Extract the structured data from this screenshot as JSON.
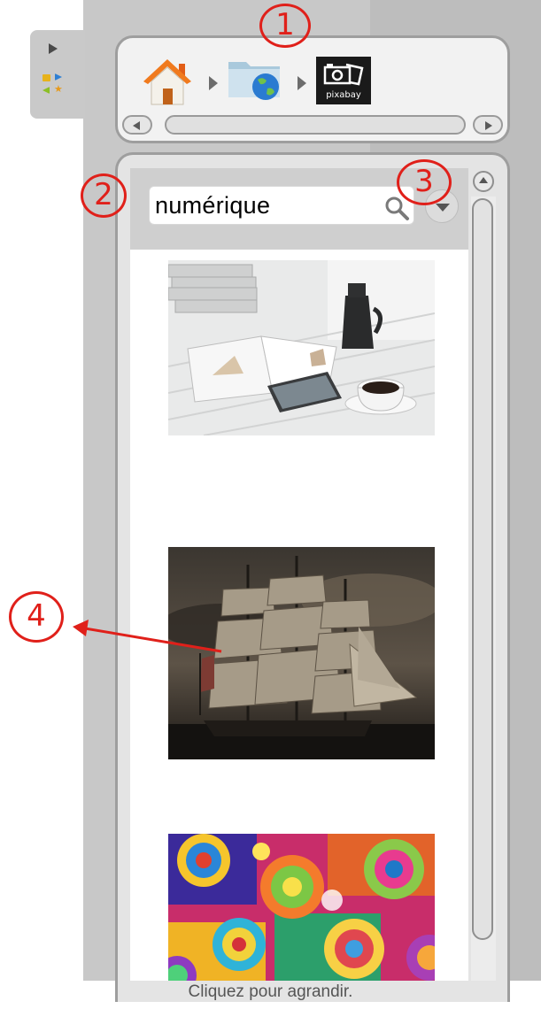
{
  "breadcrumb": {
    "items": [
      {
        "name": "home",
        "icon": "home-icon"
      },
      {
        "name": "web",
        "icon": "globe-folder-icon"
      },
      {
        "name": "pixabay",
        "icon": "camera-icon",
        "label": "pixabay"
      }
    ]
  },
  "search": {
    "value": "numérique"
  },
  "annotations": {
    "one": "1",
    "two": "2",
    "three": "3",
    "four": "4"
  },
  "caption": "Cliquez pour agrandir.",
  "colors": {
    "annotation": "#e0201a",
    "panel": "#c8c8c8",
    "pixabay_tile": "#1a1a1a"
  }
}
